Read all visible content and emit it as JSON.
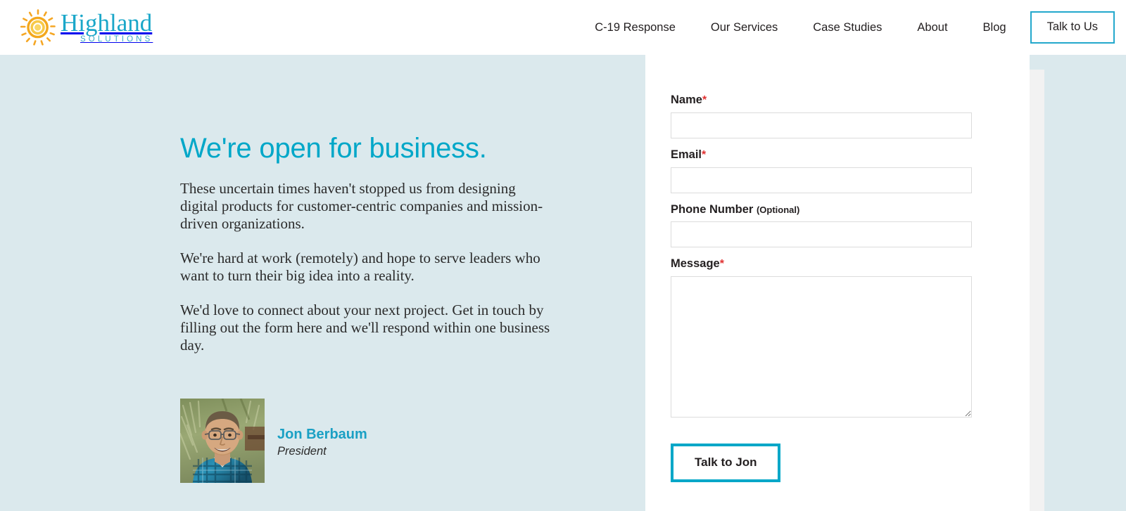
{
  "brand": {
    "name": "Highland",
    "tagline": "SOLUTIONS",
    "logo_icon": "sun-ring-icon",
    "logo_ring_color": "#F5A623",
    "logo_core_color": "#F6C945",
    "wordmark_color": "#1BA7C9"
  },
  "nav": {
    "links": [
      {
        "label": "C-19 Response"
      },
      {
        "label": "Our Services"
      },
      {
        "label": "Case Studies"
      },
      {
        "label": "About"
      },
      {
        "label": "Blog"
      }
    ],
    "cta_label": "Talk to Us",
    "cta_border_color": "#23A8CC"
  },
  "hero": {
    "title": "We're open for business.",
    "title_color": "#00A7C8",
    "background_color": "#dbe9ed",
    "paragraphs": [
      "These uncertain times haven't stopped us from designing digital products for customer-centric companies and mission-driven organizations.",
      "We're hard at work (remotely) and hope to serve leaders who want to turn their big idea into a reality.",
      "We'd love to connect about your next project. Get in touch by filling out the form here and we'll respond within one business day."
    ],
    "bio": {
      "photo_alt": "portrait-photo",
      "name": "Jon Berbaum",
      "name_color": "#1BA0C4",
      "role": "President"
    }
  },
  "form": {
    "fields": [
      {
        "id": "name",
        "label": "Name",
        "required_marker": "*",
        "optional_marker": "",
        "value": "",
        "placeholder": "",
        "type": "text"
      },
      {
        "id": "email",
        "label": "Email",
        "required_marker": "*",
        "optional_marker": "",
        "value": "",
        "placeholder": "",
        "type": "text"
      },
      {
        "id": "phone",
        "label": "Phone Number",
        "required_marker": "",
        "optional_marker": "(Optional)",
        "value": "",
        "placeholder": "",
        "type": "text"
      },
      {
        "id": "message",
        "label": "Message",
        "required_marker": "*",
        "optional_marker": "",
        "value": "",
        "placeholder": "",
        "type": "textarea"
      }
    ],
    "submit_label": "Talk to Jon",
    "submit_border_color": "#00A7C8",
    "required_color": "#e03131"
  }
}
